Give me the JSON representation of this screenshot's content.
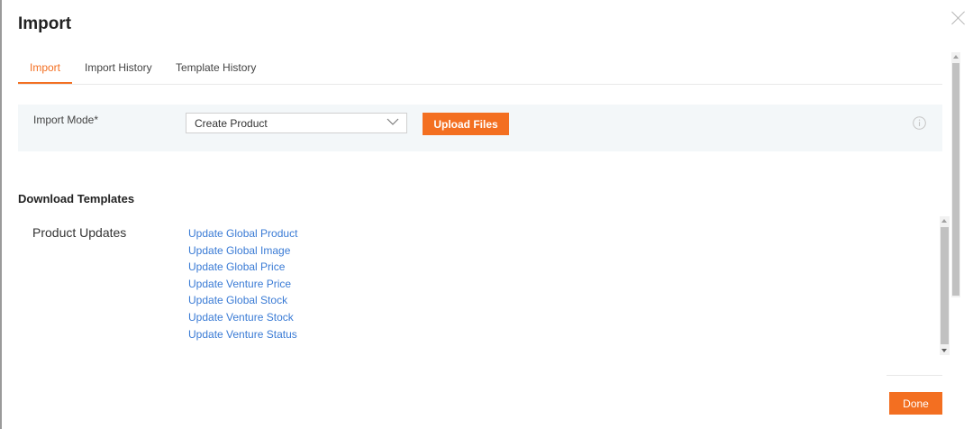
{
  "dialog": {
    "title": "Import"
  },
  "tabs": [
    {
      "label": "Import",
      "active": true
    },
    {
      "label": "Import History",
      "active": false
    },
    {
      "label": "Template History",
      "active": false
    }
  ],
  "import_mode": {
    "label": "Import Mode*",
    "selected": "Create Product",
    "upload_label": "Upload Files"
  },
  "download_templates": {
    "heading": "Download Templates",
    "section_label": "Product Updates",
    "links": [
      "Update Global Product",
      "Update Global Image",
      "Update Global Price",
      "Update Venture Price",
      "Update Global Stock",
      "Update Venture Stock",
      "Update Venture Status"
    ]
  },
  "footer": {
    "done_label": "Done"
  },
  "colors": {
    "accent": "#f36f21",
    "link": "#3a7bd5",
    "panel_bg": "#f3f7f9"
  },
  "icons": {
    "close": "close-icon",
    "dropdown": "chevron-down-icon",
    "info": "info-icon"
  }
}
